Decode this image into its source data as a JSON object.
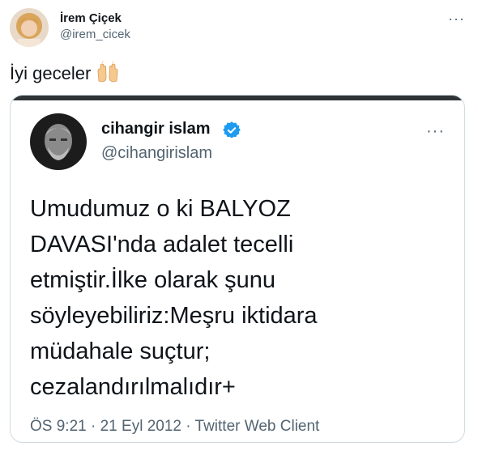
{
  "tweet": {
    "author_name": "İrem Çiçek",
    "author_handle": "@irem_cicek",
    "more_icon": "···",
    "text": "İyi geceler",
    "emoji_icon": "raised-hands-icon"
  },
  "quoted": {
    "author_name": "cihangir islam",
    "author_handle": "@cihangirislam",
    "verified_icon": "verified-badge-icon",
    "more_icon": "···",
    "lines": [
      "Umudumuz o ki BALYOZ",
      "DAVASI'nda adalet tecelli",
      "etmiştir.İlke olarak şunu",
      "söyleyebiliriz:Meşru iktidara",
      "müdahale suçtur;",
      "cezalandırılmalıdır+"
    ],
    "time": "ÖS 9:21",
    "separator": "·",
    "date": "21 Eyl 2012",
    "client": "Twitter Web Client"
  },
  "colors": {
    "text": "#0f1419",
    "secondary": "#536471",
    "verified": "#1d9bf0",
    "border": "#cfd9de"
  }
}
